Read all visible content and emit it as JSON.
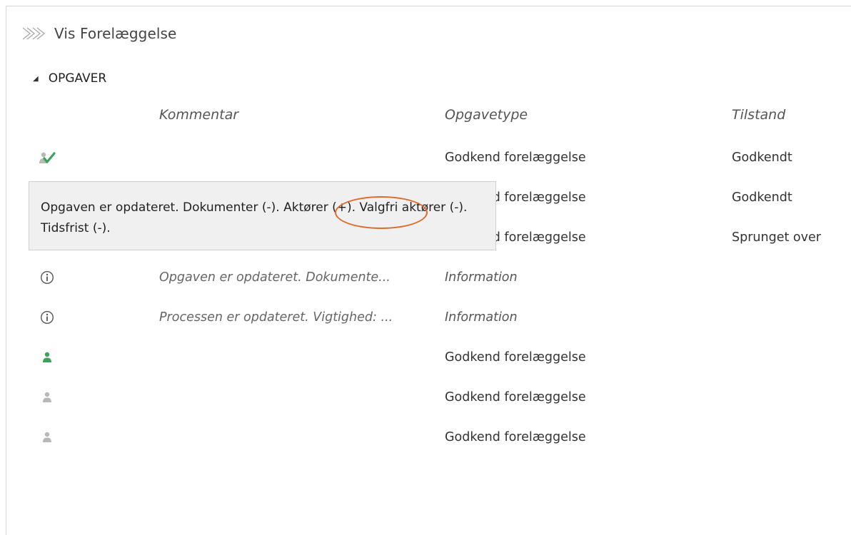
{
  "header": {
    "title": "Vis Forelæggelse",
    "icon": "double-chevron-right-icon"
  },
  "section": {
    "label": "OPGAVER",
    "expanded": true
  },
  "columns": {
    "comment": "Kommentar",
    "type": "Opgavetype",
    "state": "Tilstand"
  },
  "rows": [
    {
      "icon": "user-approved-icon",
      "comment": "",
      "type": "Godkend forelæggelse",
      "state": "Godkendt"
    },
    {
      "icon": "user-approved-icon",
      "comment": "",
      "type": "Godkend forelæggelse",
      "state": "Godkendt"
    },
    {
      "icon": "user-skipped-icon",
      "comment": "",
      "type": "Godkend forelæggelse",
      "state": "Sprunget over"
    },
    {
      "icon": "info-icon",
      "comment": "Opgaven er opdateret. Dokumente...",
      "type": "Information",
      "state": ""
    },
    {
      "icon": "info-icon",
      "comment": "Processen er opdateret. Vigtighed: ...",
      "type": "Information",
      "state": ""
    },
    {
      "icon": "user-active-icon",
      "comment": "",
      "type": "Godkend forelæggelse",
      "state": ""
    },
    {
      "icon": "user-pending-icon",
      "comment": "",
      "type": "Godkend forelæggelse",
      "state": ""
    },
    {
      "icon": "user-pending-icon",
      "comment": "",
      "type": "Godkend forelæggelse",
      "state": ""
    }
  ],
  "tooltip": {
    "text": "Opgaven er opdateret. Dokumenter (-). Aktører (+). Valgfri aktører (-). Tidsfrist (-).",
    "highlighted_phrase": "Aktører (+)"
  },
  "colors": {
    "green": "#3aa35a",
    "grey_icon": "#b8b8b8",
    "info_icon": "#555555",
    "highlight_circle": "#e06a2a",
    "tooltip_bg": "#f0f0f0"
  }
}
